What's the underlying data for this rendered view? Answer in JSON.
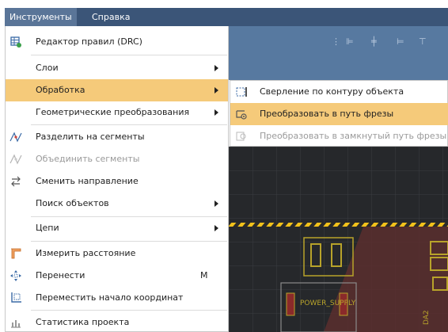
{
  "menubar": {
    "items": [
      {
        "label": "Инструменты"
      },
      {
        "label": "Справка"
      }
    ]
  },
  "tools_menu": {
    "items": [
      {
        "label": "Редактор правил (DRC)",
        "icon": "drc-rules-icon"
      },
      {
        "label": "Слои",
        "submenu": true
      },
      {
        "label": "Обработка",
        "submenu": true,
        "highlighted": true
      },
      {
        "label": "Геометрические преобразования",
        "submenu": true
      },
      {
        "label": "Разделить на сегменты",
        "icon": "split-segments-icon"
      },
      {
        "label": "Объединить сегменты",
        "icon": "merge-segments-icon",
        "disabled": true
      },
      {
        "label": "Сменить направление",
        "icon": "reverse-direction-icon"
      },
      {
        "label": "Поиск объектов",
        "submenu": true
      },
      {
        "label": "Цепи",
        "submenu": true
      },
      {
        "label": "Измерить расстояние",
        "icon": "measure-distance-icon"
      },
      {
        "label": "Перенести",
        "icon": "move-icon",
        "shortcut": "M"
      },
      {
        "label": "Переместить начало координат",
        "icon": "move-origin-icon"
      },
      {
        "label": "Статистика проекта",
        "icon": "statistics-icon"
      }
    ]
  },
  "processing_submenu": {
    "items": [
      {
        "label": "Сверление по контуру объекта",
        "icon": "contour-drilling-icon"
      },
      {
        "label": "Преобразовать в путь фрезы",
        "icon": "milling-path-icon",
        "highlighted": true
      },
      {
        "label": "Преобразовать в замкнутый путь фрезы",
        "icon": "closed-milling-path-icon",
        "disabled": true
      }
    ]
  },
  "canvas": {
    "component_label": "POWER_SUPPLY",
    "designator": "DA2"
  },
  "colors": {
    "menubar": "#3b5578",
    "highlight": "#f5ca7a",
    "toolbar": "#5779a0",
    "canvas": "#26282b",
    "hazard_stripe": "#f2c21b"
  }
}
